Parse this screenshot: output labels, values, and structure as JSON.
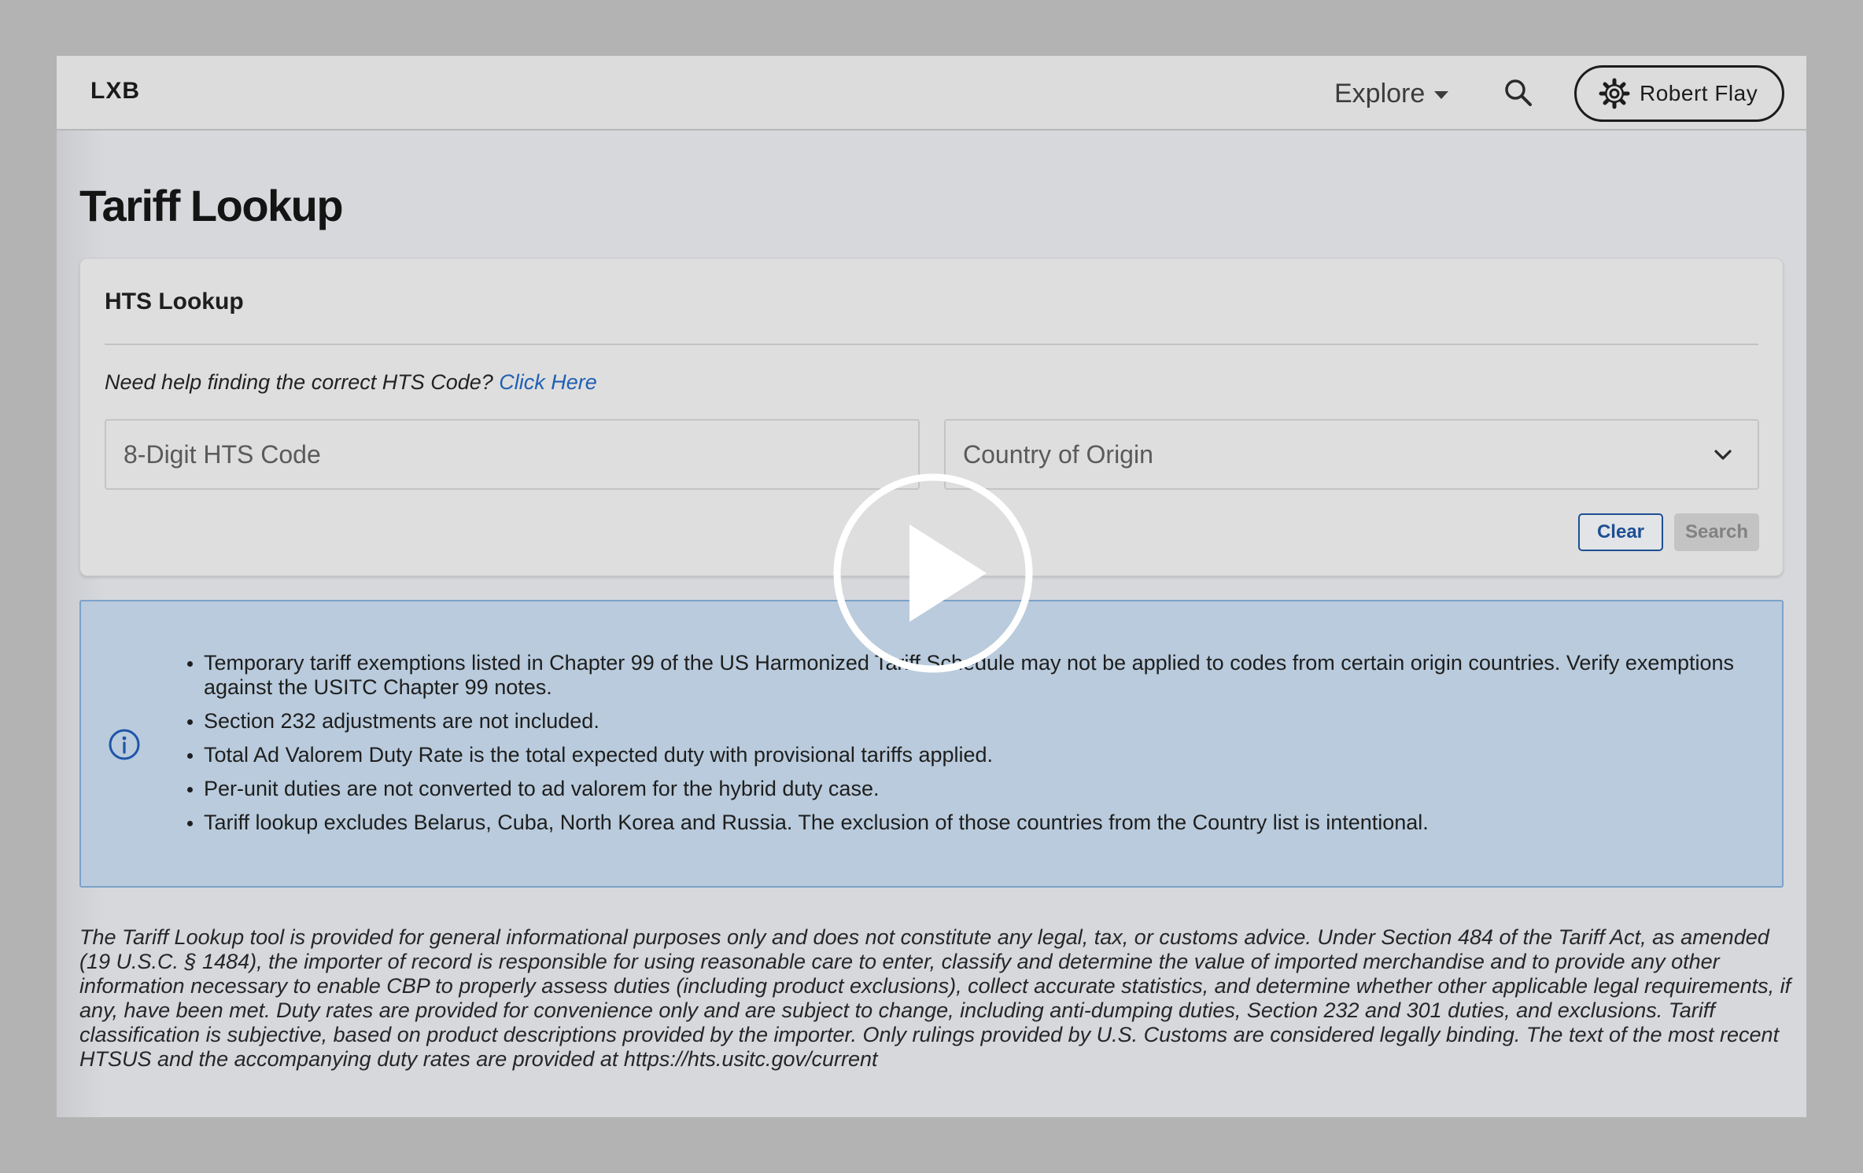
{
  "header": {
    "logo": "LXB",
    "explore_label": "Explore",
    "user_name": "Robert Flay"
  },
  "page_title": "Tariff Lookup",
  "card": {
    "title": "HTS Lookup",
    "help_text": "Need help finding the correct HTS Code?",
    "help_link": "Click Here",
    "hts_placeholder": "8-Digit HTS Code",
    "country_placeholder": "Country of Origin",
    "clear_label": "Clear",
    "search_label": "Search"
  },
  "notes": [
    "Temporary tariff exemptions listed in Chapter 99 of the US Harmonized Tariff Schedule may not be applied to codes from certain origin countries. Verify exemptions against the USITC Chapter 99 notes.",
    "Section 232 adjustments are not included.",
    "Total Ad Valorem Duty Rate is the total expected duty with provisional tariffs applied.",
    "Per-unit duties are not converted to ad valorem for the hybrid duty case.",
    "Tariff lookup excludes Belarus, Cuba, North Korea and Russia. The exclusion of those countries from the Country list is intentional."
  ],
  "disclaimer": "The Tariff Lookup tool is provided for general informational purposes only and does not constitute any legal, tax, or customs advice. Under Section 484 of the Tariff Act, as amended (19 U.S.C. § 1484), the importer of record is responsible for using reasonable care to enter, classify and determine the value of imported merchandise and to provide any other information necessary to enable CBP to properly assess duties (including product exclusions), collect accurate statistics, and determine whether other applicable legal requirements, if any, have been met. Duty rates are provided for convenience only and are subject to change, including anti-dumping duties, Section 232 and 301 duties, and exclusions. Tariff classification is subjective, based on product descriptions provided by the importer. Only rulings provided by U.S. Customs are considered legally binding. The text of the most recent HTSUS and the accompanying duty rates are provided at https://hts.usitc.gov/current",
  "icons": {
    "search": "search-icon",
    "settings": "gear-icon",
    "dropdown": "chevron-down-icon",
    "info": "info-icon",
    "play": "play-icon"
  },
  "colors": {
    "link": "#1f5fb4",
    "clear_button": "#1d4f93",
    "info_background": "#b9cbdc",
    "info_border": "#7ca2c9"
  }
}
